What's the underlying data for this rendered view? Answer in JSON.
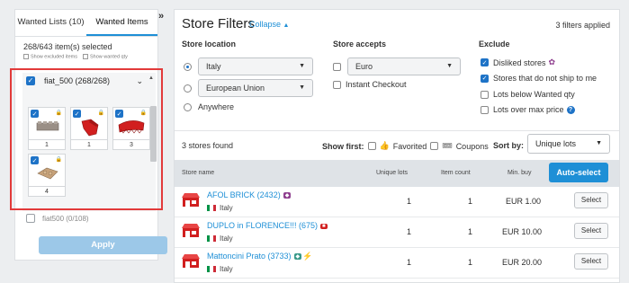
{
  "left_panel": {
    "tabs": [
      {
        "label": "Wanted Lists (10)",
        "active": false
      },
      {
        "label": "Wanted Items",
        "active": true
      }
    ],
    "collapse_glyph": "»",
    "selected_count": "268/643 item(s) selected",
    "show_excluded": "Show excluded items",
    "show_wanted": "Show wanted qty",
    "group": {
      "label": "fiat_500 (268/268)",
      "checked": true
    },
    "tiles": [
      {
        "qty": "1",
        "color": "#9a8f86"
      },
      {
        "qty": "1",
        "color": "#d11f1f"
      },
      {
        "qty": "3",
        "color": "#d11f1f"
      },
      {
        "qty": "4",
        "color": "#c7a27a"
      }
    ],
    "next_group_label": "fiat500 (0/108)",
    "apply_label": "Apply"
  },
  "filters": {
    "title": "Store Filters",
    "collapse_label": "Collapse",
    "applied": "3 filters applied",
    "store_location": {
      "heading": "Store location",
      "options": [
        {
          "label": "Italy",
          "selected": true,
          "type": "select"
        },
        {
          "label": "European Union",
          "selected": false,
          "type": "select"
        },
        {
          "label": "Anywhere",
          "selected": false,
          "type": "plain"
        }
      ]
    },
    "store_accepts": {
      "heading": "Store accepts",
      "currency": "Euro",
      "instant_checkout": "Instant Checkout"
    },
    "exclude": {
      "heading": "Exclude",
      "items": [
        {
          "label": "Disliked stores",
          "checked": true
        },
        {
          "label": "Stores that do not ship to me",
          "checked": true
        },
        {
          "label": "Lots below Wanted qty",
          "checked": false
        },
        {
          "label": "Lots over max price",
          "checked": false
        }
      ]
    }
  },
  "results": {
    "stores_found": "3 stores found",
    "show_first": "Show first:",
    "favorited": "Favorited",
    "coupons": "Coupons",
    "sort_by": "Sort by:",
    "sort_value": "Unique lots",
    "columns": {
      "store": "Store name",
      "unique": "Unique lots",
      "items": "Item count",
      "min": "Min. buy"
    },
    "auto_select": "Auto-select",
    "select_label": "Select",
    "rows": [
      {
        "name": "AFOL BRICK (2432)",
        "country": "Italy",
        "unique": "1",
        "count": "1",
        "min": "EUR 1.00",
        "badge_color": "#8e3e8e"
      },
      {
        "name": "DUPLO in FLORENCE!!! (675)",
        "country": "Italy",
        "unique": "1",
        "count": "1",
        "min": "EUR 10.00",
        "badge_color": "#d11f1f"
      },
      {
        "name": "Mattoncini Prato (3733)",
        "country": "Italy",
        "unique": "1",
        "count": "1",
        "min": "EUR 20.00",
        "badge_color": "#3a9a8a"
      }
    ]
  }
}
